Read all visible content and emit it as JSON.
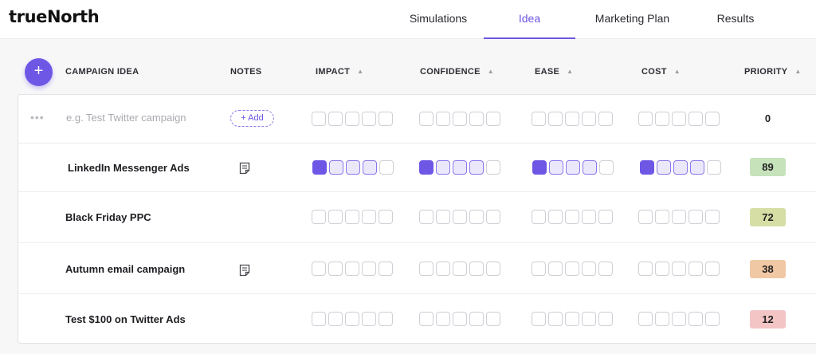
{
  "app": {
    "logo": "trueNorth"
  },
  "nav": {
    "tabs": [
      {
        "label": "Simulations",
        "active": false
      },
      {
        "label": "Idea",
        "active": true
      },
      {
        "label": "Marketing Plan",
        "active": false
      },
      {
        "label": "Results",
        "active": false
      }
    ]
  },
  "table": {
    "add_button": "+",
    "columns": {
      "idea": "CAMPAIGN IDEA",
      "notes": "NOTES",
      "impact": "IMPACT",
      "confidence": "CONFIDENCE",
      "ease": "EASE",
      "cost": "COST",
      "priority": "PRIORITY"
    },
    "sort_icon": "sort-up-down-icon",
    "new_row": {
      "placeholder": "e.g. Test Twitter campaign",
      "add_note_label": "+ Add",
      "priority": "0",
      "ratings": {
        "impact": 0,
        "confidence": 0,
        "ease": 0,
        "cost": 0
      },
      "scale_max": 5
    },
    "rows": [
      {
        "title": "LinkedIn Messenger Ads",
        "has_note": true,
        "priority": "89",
        "priority_color": "#c6e2bb",
        "ratings": {
          "impact": 4,
          "confidence": 4,
          "ease": 4,
          "cost": 4
        }
      },
      {
        "title": "Black Friday PPC",
        "has_note": false,
        "priority": "72",
        "priority_color": "#d7dea5",
        "ratings": {
          "impact": 0,
          "confidence": 0,
          "ease": 0,
          "cost": 0
        }
      },
      {
        "title": "Autumn email campaign",
        "has_note": true,
        "priority": "38",
        "priority_color": "#f1c8a4",
        "ratings": {
          "impact": 0,
          "confidence": 0,
          "ease": 0,
          "cost": 0
        }
      },
      {
        "title": "Test $100 on Twitter Ads",
        "has_note": false,
        "priority": "12",
        "priority_color": "#f3c5c5",
        "ratings": {
          "impact": 0,
          "confidence": 0,
          "ease": 0,
          "cost": 0
        }
      }
    ]
  },
  "colors": {
    "accent": "#6f57e6",
    "accent_light": "#ece8fb"
  }
}
